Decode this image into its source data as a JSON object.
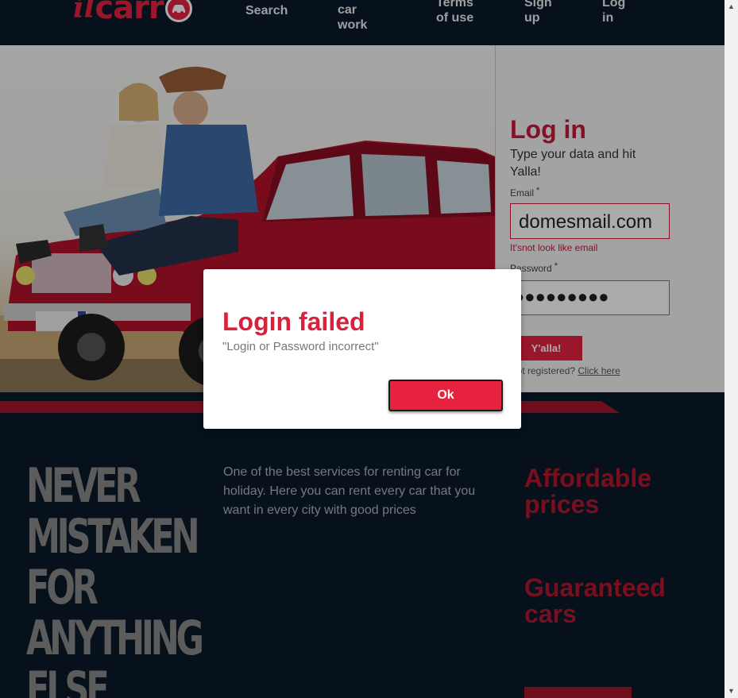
{
  "header": {
    "logo": "ilcarro",
    "nav": [
      "Search",
      "Let the car work",
      "Terms of use",
      "Sign up",
      "Log in"
    ]
  },
  "login": {
    "title": "Log in",
    "subtitle": "Type your data and hit Yalla!",
    "email_label": "Email",
    "email_value": "domesmail.com",
    "email_error": "It'snot look like email",
    "password_label": "Password",
    "password_value": "●●●●●●●●●",
    "submit_label": "Y'alla!",
    "not_registered_text": "Not registered?",
    "click_here_label": "Click here"
  },
  "modal": {
    "title": "Login failed",
    "message": "\"Login or Password incorrect\"",
    "ok_label": "Ok"
  },
  "lower": {
    "slogan": [
      "NEVER",
      "MISTAKEN",
      "FOR",
      "ANYTHING",
      "ELSE"
    ],
    "description": "One of the best services for renting car for holiday. Here you can rent every car that you want in every city with good prices",
    "features": [
      "Affordable prices",
      "Guaranteed cars"
    ]
  },
  "colors": {
    "accent": "#e6223f",
    "dark_bg": "#0b1a2a"
  }
}
